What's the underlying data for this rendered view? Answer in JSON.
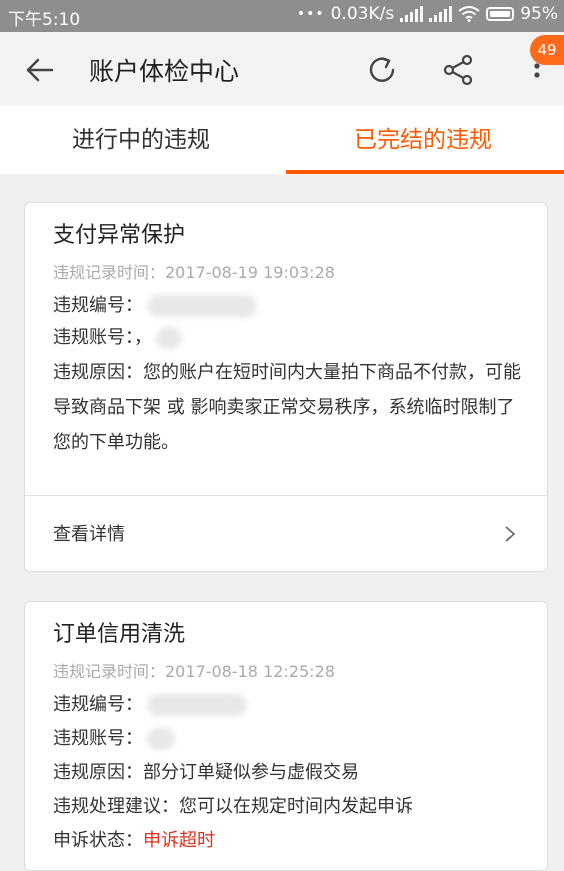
{
  "status_bar": {
    "time": "下午5:10",
    "network_speed": "0.03K/s",
    "battery_percent": "95%"
  },
  "header": {
    "title": "账户体检中心",
    "notification_count": "49"
  },
  "tabs": {
    "ongoing": "进行中的违规",
    "completed": "已完结的违规",
    "active": "completed"
  },
  "violations": [
    {
      "title": "支付异常保护",
      "record_time": "违规记录时间：2017-08-19 19:03:28",
      "number_label": "违规编号：",
      "account_label": "违规账号：",
      "account_partial": "，",
      "reason": "违规原因：您的账户在短时间内大量拍下商品不付款，可能导致商品下架 或 影响卖家正常交易秩序，系统临时限制了您的下单功能。",
      "details_label": "查看详情",
      "chevron": ">"
    },
    {
      "title": "订单信用清洗",
      "record_time": "违规记录时间：2017-08-18 12:25:28",
      "number_label": "违规编号：",
      "account_label": "违规账号：",
      "reason": "违规原因：部分订单疑似参与虚假交易",
      "suggestion": "违规处理建议：您可以在规定时间内发起申诉",
      "appeal_status_label": "申诉状态：",
      "appeal_status_value": "申诉超时"
    }
  ],
  "colors": {
    "accent": "#ff5a00",
    "badge": "#ff6a1a",
    "alert_red": "#e0321e",
    "status_bar": "#8e8e8e"
  },
  "icons": [
    "back-arrow-icon",
    "refresh-icon",
    "share-icon",
    "more-vertical-icon",
    "chevron-right-icon",
    "wifi-icon",
    "signal-icon",
    "battery-icon"
  ]
}
